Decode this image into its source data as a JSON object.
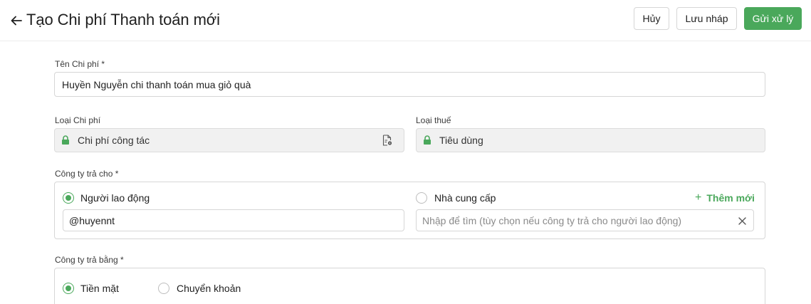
{
  "header": {
    "title": "Tạo Chi phí Thanh toán mới",
    "back_icon": "arrow-left-icon",
    "buttons": {
      "cancel": "Hủy",
      "draft": "Lưu nháp",
      "submit": "Gửi xử lý"
    }
  },
  "form": {
    "expense_name": {
      "label": "Tên Chi phí *",
      "value": "Huyền Nguyễn chi thanh toán mua giỏ quà"
    },
    "expense_type": {
      "label": "Loại Chi phí",
      "value": "Chi phí công tác",
      "icon": "lock-icon",
      "trailing_icon": "document-settings-icon"
    },
    "tax_type": {
      "label": "Loại thuế",
      "value": "Tiêu dùng",
      "icon": "lock-icon"
    },
    "paid_to": {
      "label": "Công ty trả cho *",
      "options": [
        {
          "label": "Người lao động",
          "checked": true
        },
        {
          "label": "Nhà cung cấp",
          "checked": false
        }
      ],
      "add_new": "Thêm mới",
      "employee_value": "@huyennt",
      "supplier_placeholder": "Nhập để tìm (tùy chọn nếu công ty trả cho người lao động)",
      "clear_icon": "close-icon"
    },
    "paid_by": {
      "label": "Công ty trả bằng *",
      "options": [
        {
          "label": "Tiền mặt",
          "checked": true
        },
        {
          "label": "Chuyển khoản",
          "checked": false
        }
      ]
    }
  },
  "colors": {
    "accent": "#4aa85b",
    "border": "#d6d6d6",
    "locked_bg": "#f1f1f1"
  }
}
